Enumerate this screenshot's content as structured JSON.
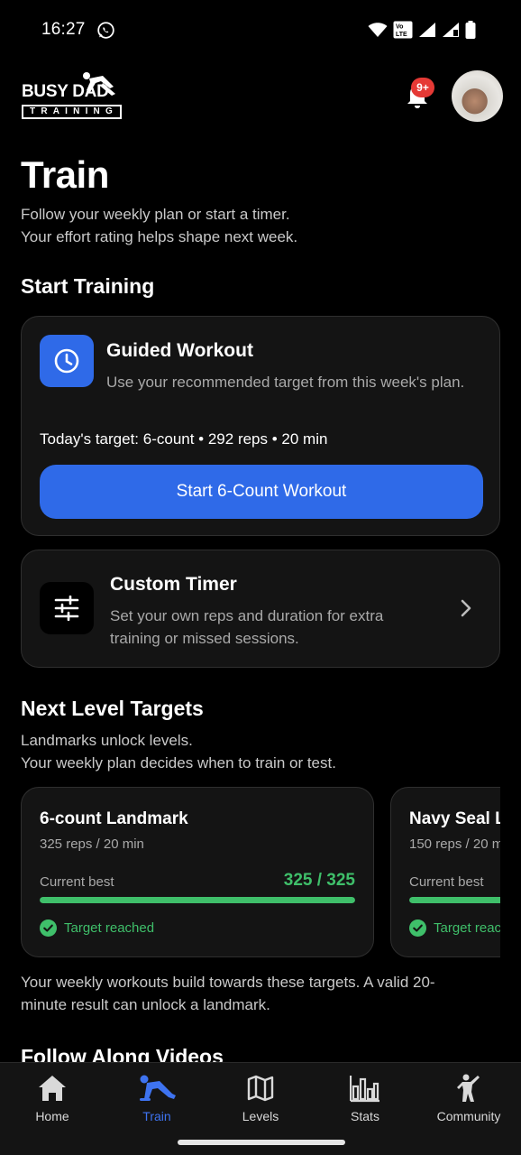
{
  "status_bar": {
    "time": "16:27",
    "volte": "Vo LTE",
    "sim": "R"
  },
  "header": {
    "logo_top": "BUSY DAD",
    "logo_bottom": "TRAINING",
    "notification_badge": "9+"
  },
  "page": {
    "title": "Train",
    "subtitle_line1": "Follow your weekly plan or start a timer.",
    "subtitle_line2": "Your effort rating helps shape next week."
  },
  "start_training": {
    "heading": "Start Training",
    "guided": {
      "title": "Guided Workout",
      "description": "Use your recommended target from this week's plan.",
      "target": "Today's target: 6-count • 292 reps • 20 min",
      "button": "Start 6-Count Workout"
    },
    "custom": {
      "title": "Custom Timer",
      "description": "Set your own reps and duration for extra training or missed sessions."
    }
  },
  "next_level": {
    "heading": "Next Level Targets",
    "sub_line1": "Landmarks unlock levels.",
    "sub_line2": "Your weekly plan decides when to train or test.",
    "cards": [
      {
        "title": "6-count Landmark",
        "meta": "325 reps / 20 min",
        "current_label": "Current best",
        "value": "325 / 325",
        "progress": 1.0,
        "status": "Target reached"
      },
      {
        "title": "Navy Seal Landmark",
        "meta": "150 reps / 20 min",
        "current_label": "Current best",
        "value": "",
        "progress": 1.0,
        "status": "Target reached"
      }
    ],
    "footer": "Your weekly workouts build towards these targets. A valid 20-minute result can unlock a landmark."
  },
  "follow_along": {
    "heading": "Follow Along Videos"
  },
  "bottom_nav": {
    "items": [
      {
        "label": "Home",
        "icon": "home-icon"
      },
      {
        "label": "Train",
        "icon": "pushup-icon",
        "active": true
      },
      {
        "label": "Levels",
        "icon": "map-icon"
      },
      {
        "label": "Stats",
        "icon": "bar-chart-icon"
      },
      {
        "label": "Community",
        "icon": "person-icon"
      }
    ]
  },
  "colors": {
    "accent": "#2f6ae8",
    "success": "#3fbf6a",
    "badge": "#e53935",
    "background": "#000000",
    "card": "#141414"
  }
}
